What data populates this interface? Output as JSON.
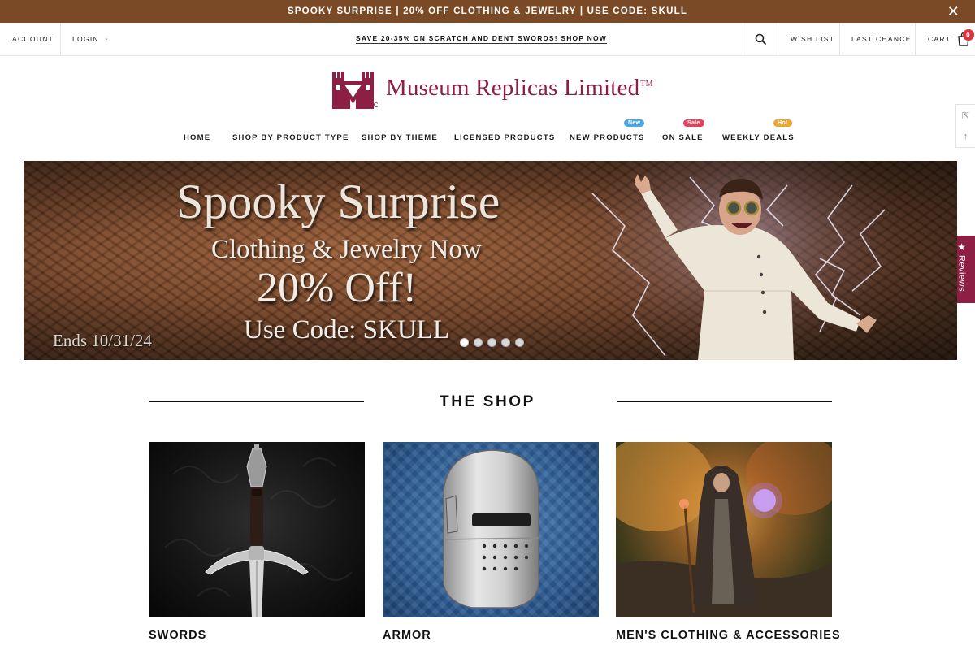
{
  "announcement": {
    "text": "SPOOKY SURPRISE | 20% OFF CLOTHING & JEWELRY | USE CODE: SKULL",
    "close": "✕"
  },
  "utility": {
    "account": "ACCOUNT",
    "login": "LOGIN",
    "promo": "SAVE 20-35% ON SCRATCH AND DENT SWORDS! SHOP NOW",
    "wishlist": "WISH LIST",
    "last_chance": "LAST CHANCE",
    "cart": "CART",
    "cart_count": "0"
  },
  "logo": {
    "text": "Museum Replicas Limited",
    "tm": "TM",
    "brand_color": "#8d1f45"
  },
  "nav": {
    "items": [
      {
        "label": "HOME"
      },
      {
        "label": "SHOP BY PRODUCT TYPE"
      },
      {
        "label": "SHOP BY THEME"
      },
      {
        "label": "LICENSED PRODUCTS"
      },
      {
        "label": "NEW PRODUCTS",
        "badge": "New",
        "badge_color": "#4aa6e8"
      },
      {
        "label": "ON SALE",
        "badge": "Sale",
        "badge_color": "#e8405a"
      },
      {
        "label": "WEEKLY DEALS",
        "badge": "Hot",
        "badge_color": "#f0a431"
      }
    ]
  },
  "hero": {
    "headline": "Spooky Surprise",
    "line2": "Clothing & Jewelry Now",
    "line3": "20% Off!",
    "line4": "Use Code: SKULL",
    "ends": "Ends 10/31/24",
    "slides": 5,
    "active_slide": 1
  },
  "reviews_tab": {
    "label": "Reviews"
  },
  "shop": {
    "title": "THE SHOP",
    "categories": [
      {
        "label": "SWORDS",
        "image": "sword-image"
      },
      {
        "label": "ARMOR",
        "image": "knight-helmet-image"
      },
      {
        "label": "MEN'S CLOTHING & ACCESSORIES",
        "image": "wizard-robe-image"
      }
    ]
  },
  "icons": {
    "search": "search-icon",
    "cart": "cart-bag-icon",
    "close": "close-icon",
    "chevron": "chevron-down-icon",
    "compare": "compare-icon",
    "back_to_top": "arrow-up-icon",
    "star": "star-icon"
  },
  "colors": {
    "announcement_bg": "#7a4a26",
    "brand": "#8d1f45",
    "text": "#111111"
  }
}
